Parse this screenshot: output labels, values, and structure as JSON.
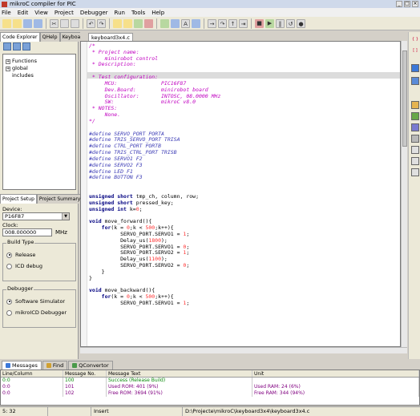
{
  "window": {
    "title": "mikroC compiler for PIC"
  },
  "menu": [
    "File",
    "Edit",
    "View",
    "Project",
    "Debugger",
    "Run",
    "Tools",
    "Help"
  ],
  "left_panel": {
    "tabs": [
      "Code Explorer",
      "QHelp",
      "Keyboard"
    ],
    "tree": [
      {
        "expander": "+",
        "label": "Functions"
      },
      {
        "expander": "+",
        "label": "global"
      },
      {
        "expander": "",
        "label": "includes"
      }
    ],
    "project_tabs": [
      "Project Setup",
      "Project Summary"
    ],
    "device_label": "Device:",
    "device_value": "P16F87",
    "clock_label": "Clock:",
    "clock_value": "008.000000",
    "clock_unit": "MHz",
    "build_type_title": "Build Type",
    "build_options": [
      "Release",
      "ICD debug"
    ],
    "debugger_title": "Debugger",
    "debugger_options": [
      "Software Simulator",
      "mikroICD Debugger"
    ]
  },
  "editor": {
    "tab_label": "keyboard3x4.c",
    "lines": [
      [
        [
          "c-com",
          "/*"
        ]
      ],
      [
        [
          "c-com",
          " * Project name:"
        ]
      ],
      [
        [
          "c-com",
          "     minirobot control"
        ]
      ],
      [
        [
          "c-com",
          " * Description:"
        ]
      ],
      [
        [
          "c-com",
          ""
        ]
      ],
      [
        [
          "c-com",
          " * Test configuration:"
        ]
      ],
      [
        [
          "c-com",
          "     MCU:              PIC16F87"
        ]
      ],
      [
        [
          "c-com",
          "     Dev.Board:        minirobot board"
        ]
      ],
      [
        [
          "c-com",
          "     Oscillator:       INTOSC, 08.0000 MHz"
        ]
      ],
      [
        [
          "c-com",
          "     SW:               mikroC v8.0"
        ]
      ],
      [
        [
          "c-com",
          " * NOTES:"
        ]
      ],
      [
        [
          "c-com",
          "     None."
        ]
      ],
      [
        [
          "c-com",
          "*/"
        ]
      ],
      [
        [
          "c-n",
          ""
        ]
      ],
      [
        [
          "c-pp",
          "#define SERVO_PORT PORTA"
        ]
      ],
      [
        [
          "c-pp",
          "#define TRIS_SERVO_PORT TRISA"
        ]
      ],
      [
        [
          "c-pp",
          "#define CTRL_PORT PORTB"
        ]
      ],
      [
        [
          "c-pp",
          "#define TRIS_CTRL_PORT TRISB"
        ]
      ],
      [
        [
          "c-pp",
          "#define SERVO1 F2"
        ]
      ],
      [
        [
          "c-pp",
          "#define SERVO2 F3"
        ]
      ],
      [
        [
          "c-pp",
          "#define LED F1"
        ]
      ],
      [
        [
          "c-pp",
          "#define BUTTON F3"
        ]
      ],
      [
        [
          "c-n",
          ""
        ]
      ],
      [
        [
          "c-n",
          ""
        ]
      ],
      [
        [
          "c-kw",
          "unsigned short"
        ],
        [
          "c-n",
          " tmp_ch, column, row;"
        ]
      ],
      [
        [
          "c-kw",
          "unsigned short"
        ],
        [
          "c-n",
          " pressed_key;"
        ]
      ],
      [
        [
          "c-kw",
          "unsigned int"
        ],
        [
          "c-n",
          " k="
        ],
        [
          "c-num",
          "0"
        ],
        [
          "c-n",
          ";"
        ]
      ],
      [
        [
          "c-n",
          ""
        ]
      ],
      [
        [
          "c-kw",
          "void"
        ],
        [
          "c-n",
          " move_forward(){"
        ]
      ],
      [
        [
          "c-n",
          "    "
        ],
        [
          "c-kw",
          "for"
        ],
        [
          "c-n",
          "(k = "
        ],
        [
          "c-num",
          "0"
        ],
        [
          "c-n",
          ";k < "
        ],
        [
          "c-num",
          "500"
        ],
        [
          "c-n",
          ";k++){"
        ]
      ],
      [
        [
          "c-n",
          "          SERVO_PORT.SERVO1 = "
        ],
        [
          "c-num",
          "1"
        ],
        [
          "c-n",
          ";"
        ]
      ],
      [
        [
          "c-n",
          "          Delay_us("
        ],
        [
          "c-num",
          "1800"
        ],
        [
          "c-n",
          ");"
        ]
      ],
      [
        [
          "c-n",
          "          SERVO_PORT.SERVO1 = "
        ],
        [
          "c-num",
          "0"
        ],
        [
          "c-n",
          ";"
        ]
      ],
      [
        [
          "c-n",
          "          SERVO_PORT.SERVO2 = "
        ],
        [
          "c-num",
          "1"
        ],
        [
          "c-n",
          ";"
        ]
      ],
      [
        [
          "c-n",
          "          Delay_us("
        ],
        [
          "c-num",
          "1100"
        ],
        [
          "c-n",
          ");"
        ]
      ],
      [
        [
          "c-n",
          "          SERVO_PORT.SERVO2 = "
        ],
        [
          "c-num",
          "0"
        ],
        [
          "c-n",
          ";"
        ]
      ],
      [
        [
          "c-n",
          "    }"
        ]
      ],
      [
        [
          "c-n",
          "}"
        ]
      ],
      [
        [
          "c-n",
          ""
        ]
      ],
      [
        [
          "c-kw",
          "void"
        ],
        [
          "c-n",
          " move_backward(){"
        ]
      ],
      [
        [
          "c-n",
          "    "
        ],
        [
          "c-kw",
          "for"
        ],
        [
          "c-n",
          "(k = "
        ],
        [
          "c-num",
          "0"
        ],
        [
          "c-n",
          ";k < "
        ],
        [
          "c-num",
          "500"
        ],
        [
          "c-n",
          ";k++){"
        ]
      ],
      [
        [
          "c-n",
          "          SERVO_PORT.SERVO1 = "
        ],
        [
          "c-num",
          "1"
        ],
        [
          "c-n",
          ";"
        ]
      ]
    ]
  },
  "bottom": {
    "tabs": [
      "Messages",
      "Find",
      "QConvertor"
    ],
    "headers": [
      "Line/Column",
      "Message No.",
      "Message Text",
      "Unit"
    ],
    "rows": [
      {
        "kind": "ok",
        "cells": [
          "0:0",
          "100",
          "Success (Release Build)",
          ""
        ]
      },
      {
        "kind": "info",
        "cells": [
          "0:0",
          "101",
          "Used ROM: 401  (9%)",
          "Used RAM: 24  (6%)"
        ]
      },
      {
        "kind": "info",
        "cells": [
          "0:0",
          "102",
          "Free ROM: 3694  (91%)",
          "Free RAM: 344  (94%)"
        ]
      }
    ]
  },
  "status": {
    "position": "5: 32",
    "modified": "",
    "mode": "Insert",
    "path": "D:\\Projecte\\mikroC\\keyboard3x4\\keyboard3x4.c"
  }
}
